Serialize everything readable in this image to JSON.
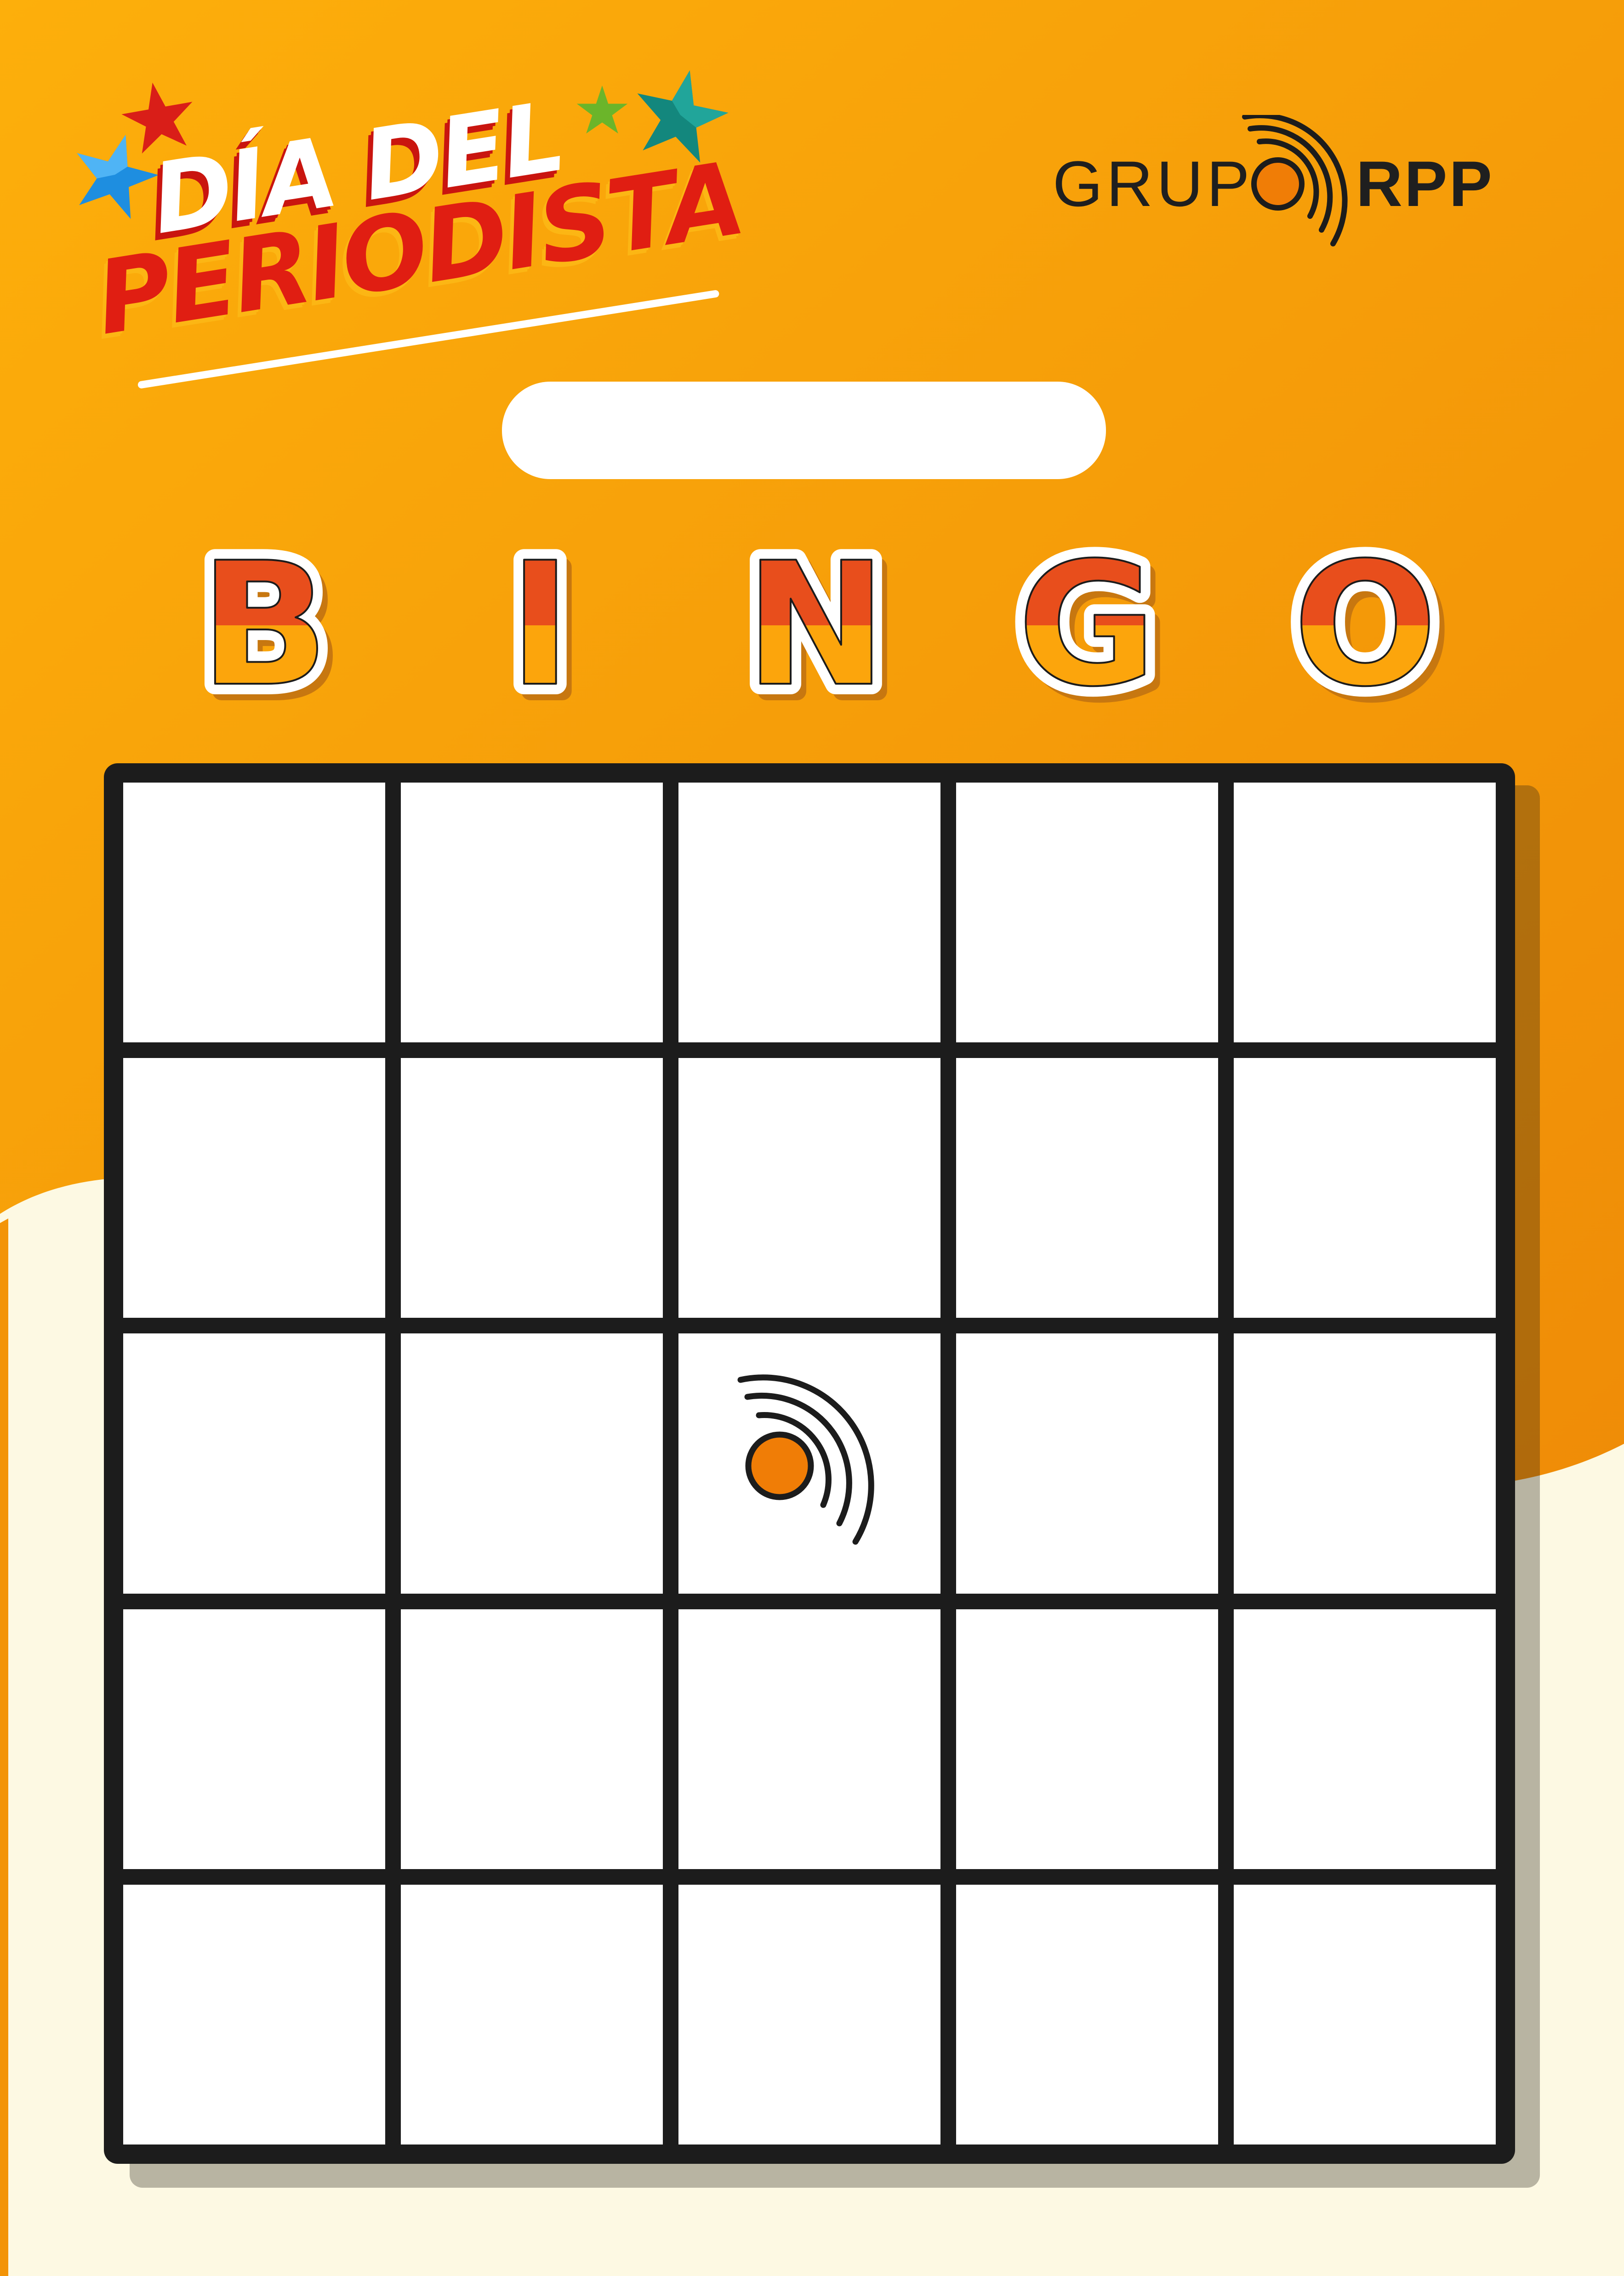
{
  "event_title": {
    "line1": "DÍA DEL",
    "line2": "PERIODISTA"
  },
  "brand": {
    "grupo": "GRUPO",
    "rpp": "RPP",
    "icon": "rpp-signal-icon"
  },
  "name_field": {
    "value": ""
  },
  "header_letters": [
    "B",
    "I",
    "N",
    "G",
    "O"
  ],
  "board": {
    "rows": 5,
    "columns": 5,
    "cells": [
      [
        "",
        "",
        "",
        "",
        ""
      ],
      [
        "",
        "",
        "",
        "",
        ""
      ],
      [
        "",
        "",
        "",
        "",
        ""
      ],
      [
        "",
        "",
        "",
        "",
        ""
      ],
      [
        "",
        "",
        "",
        "",
        ""
      ]
    ],
    "free_space_icon": "rpp-signal-icon"
  },
  "colors": {
    "orange_top": "#fcae0b",
    "orange_bottom": "#f19008",
    "cream": "#fdf9e3",
    "letter_top": "#e84e1c",
    "letter_bottom": "#fca50c",
    "board_line": "#1c1c1c",
    "rpp_orange": "#f07d06"
  }
}
